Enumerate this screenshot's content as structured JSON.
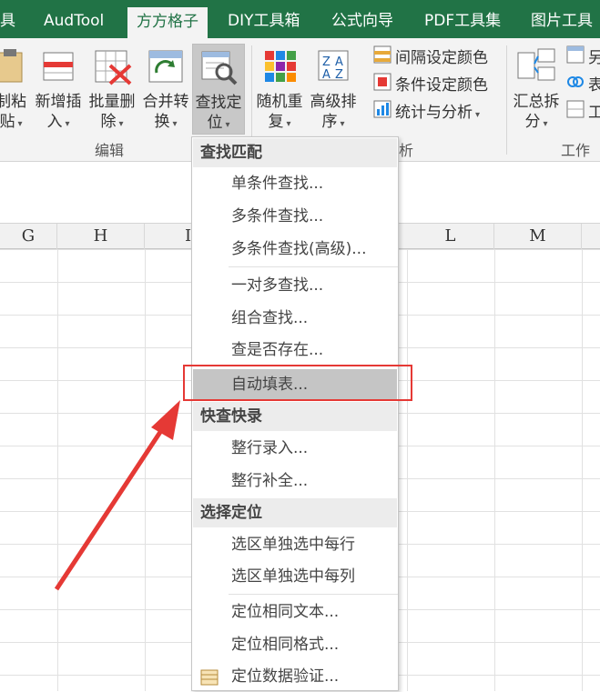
{
  "tabs": [
    {
      "label": "具"
    },
    {
      "label": "AudTool"
    },
    {
      "label": "方方格子",
      "active": true
    },
    {
      "label": "DIY工具箱"
    },
    {
      "label": "公式向导"
    },
    {
      "label": "PDF工具集"
    },
    {
      "label": "图片工具"
    }
  ],
  "ribbon": {
    "paste": {
      "line1": "制粘",
      "line2": "贴"
    },
    "insert": {
      "line1": "新增插",
      "line2": "入"
    },
    "bulk_delete": {
      "line1": "批量删",
      "line2": "除"
    },
    "merge": {
      "line1": "合并转",
      "line2": "换"
    },
    "find": {
      "line1": "查找定",
      "line2": "位"
    },
    "random": {
      "line1": "随机重",
      "line2": "复"
    },
    "sort": {
      "line1": "高级排",
      "line2": "序"
    },
    "interval_color": "间隔设定颜色",
    "cond_color": "条件设定颜色",
    "stats": "统计与分析",
    "summary": {
      "line1": "汇总拆",
      "line2": "分"
    },
    "right_items": [
      "另",
      "表",
      "工"
    ],
    "group_edit": "编辑",
    "group_analysis": "析",
    "group_worksheet": "工作表"
  },
  "columns": [
    "G",
    "H",
    "I",
    "L",
    "M"
  ],
  "menu": {
    "section_find": "查找匹配",
    "items_find": [
      "单条件查找...",
      "多条件查找...",
      "多条件查找(高级)...",
      "一对多查找...",
      "组合查找...",
      "查是否存在...",
      "自动填表..."
    ],
    "section_quick": "快查快录",
    "items_quick": [
      "整行录入...",
      "整行补全..."
    ],
    "section_select": "选择定位",
    "items_select": [
      "选区单独选中每行",
      "选区单独选中每列",
      "定位相同文本...",
      "定位相同格式...",
      "定位数据验证..."
    ]
  },
  "colors": {
    "tab_bg": "#217346",
    "highlight_box": "#e53935",
    "arrow": "#e53935"
  }
}
